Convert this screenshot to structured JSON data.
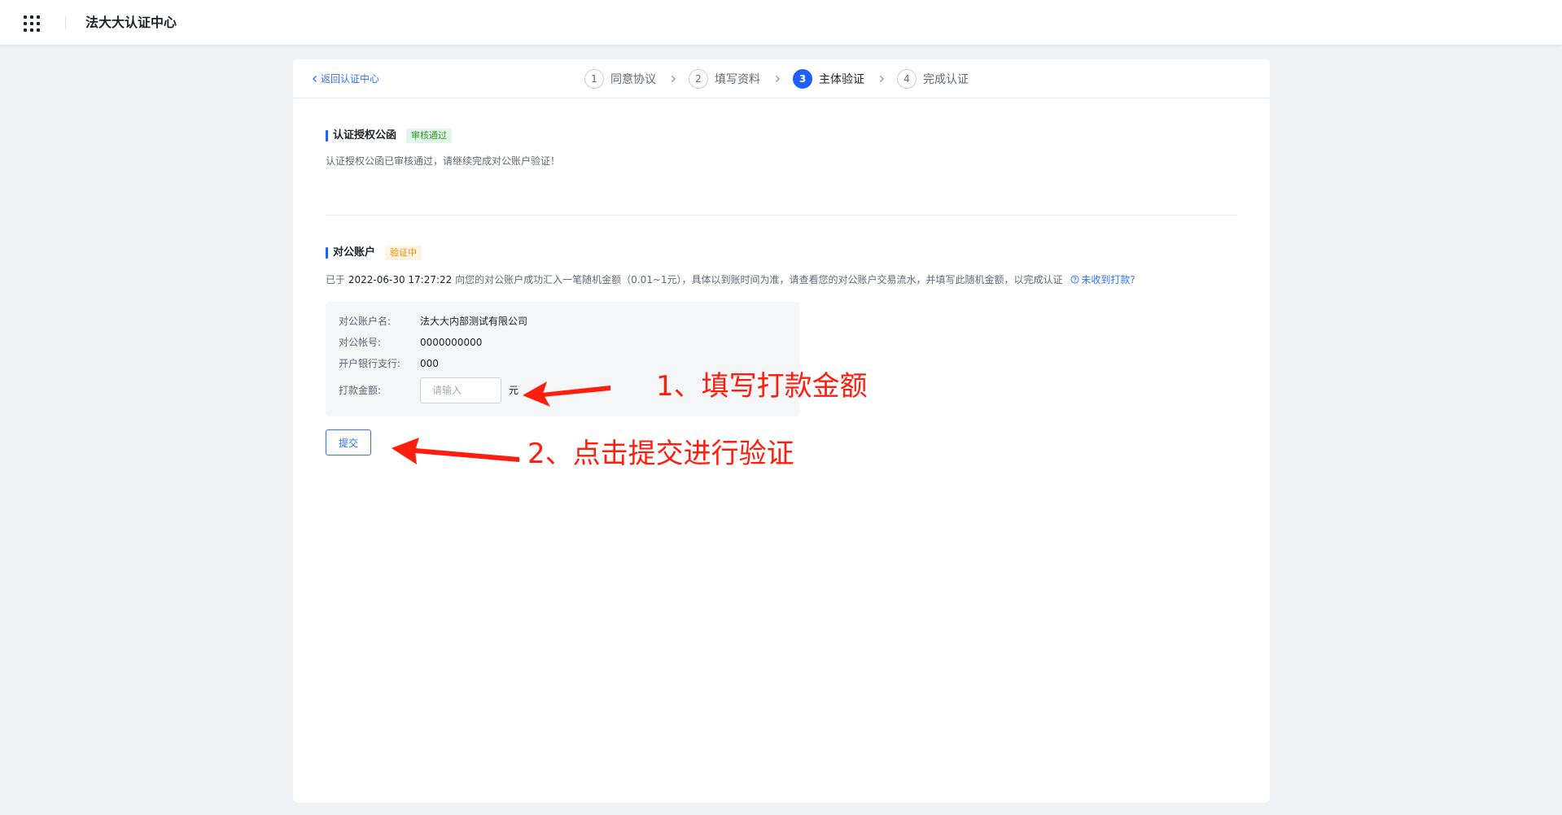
{
  "header": {
    "app_title": "法大大认证中心"
  },
  "card": {
    "back_label": "返回认证中心",
    "steps": [
      {
        "num": "1",
        "label": "同意协议"
      },
      {
        "num": "2",
        "label": "填写资料"
      },
      {
        "num": "3",
        "label": "主体验证"
      },
      {
        "num": "4",
        "label": "完成认证"
      }
    ],
    "current_step": 3
  },
  "letter_section": {
    "title": "认证授权公函",
    "status_tag": "审核通过",
    "description": "认证授权公函已审核通过，请继续完成对公账户验证！"
  },
  "account_section": {
    "title": "对公账户",
    "status_tag": "验证中",
    "desc_prefix": "已于",
    "desc_time": "2022-06-30 17:27:22",
    "desc_text": "向您的对公账户成功汇入一笔随机金额（0.01~1元），具体以到账时间为准，请查看您的对公账户交易流水，并填写此随机金额，以完成认证",
    "not_received_link": "未收到打款?",
    "fields": {
      "account_name_label": "对公账户名:",
      "account_name_value": "法大大内部测试有限公司",
      "account_no_label": "对公帐号:",
      "account_no_value": "0000000000",
      "bank_branch_label": "开户银行支行:",
      "bank_branch_value": "000",
      "amount_label": "打款金额:",
      "amount_placeholder": "请输入",
      "amount_value": "",
      "amount_unit": "元"
    },
    "submit_label": "提交"
  },
  "annotations": {
    "step1": "1、填写打款金额",
    "step2": "2、点击提交进行验证",
    "color": "#ff1d0d"
  },
  "colors": {
    "primary": "#1f5eff",
    "link": "#3370ff",
    "success": "#2ea121",
    "warning": "#ff8800"
  }
}
